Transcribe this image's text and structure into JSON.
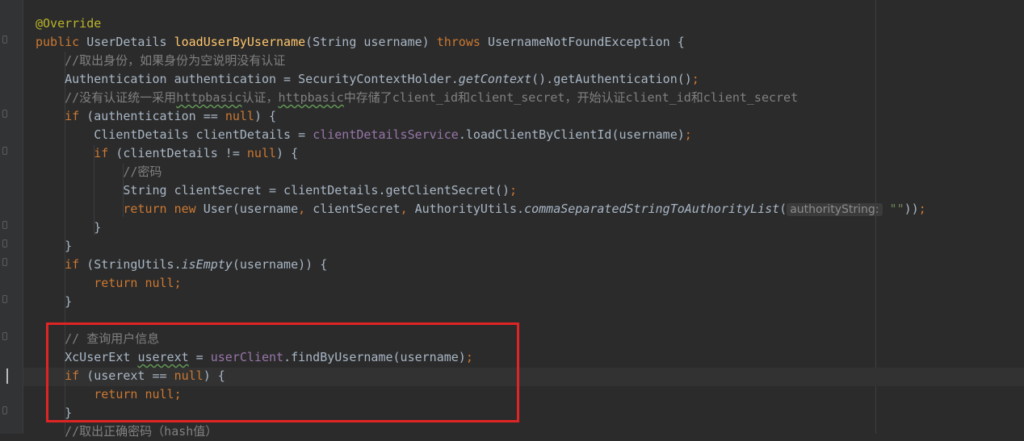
{
  "code_lines": [
    {
      "indent": "",
      "segments": [
        {
          "t": "@Override",
          "c": "ann"
        }
      ]
    },
    {
      "indent": "",
      "segments": [
        {
          "t": "public ",
          "c": "kw"
        },
        {
          "t": "UserDetails "
        },
        {
          "t": "loadUserByUsername",
          "c": "fn"
        },
        {
          "t": "(String username) "
        },
        {
          "t": "throws ",
          "c": "kw"
        },
        {
          "t": "UsernameNotFoundException {"
        }
      ]
    },
    {
      "indent": "    ",
      "segments": [
        {
          "t": "//取出身份，如果身份为空说明没有认证",
          "c": "cmt"
        }
      ]
    },
    {
      "indent": "    ",
      "segments": [
        {
          "t": "Authentication authentication = SecurityContextHolder."
        },
        {
          "t": "getContext",
          "c": "it"
        },
        {
          "t": "().getAuthentication()"
        },
        {
          "t": ";",
          "c": "kw"
        }
      ]
    },
    {
      "indent": "    ",
      "segments": [
        {
          "t": "//没有认证统一采用",
          "c": "cmt"
        },
        {
          "t": "httpbasic",
          "c": "cmt typo"
        },
        {
          "t": "认证，",
          "c": "cmt"
        },
        {
          "t": "httpbasic",
          "c": "cmt typo"
        },
        {
          "t": "中存储了client_id和client_secret，开始认证client_id和client_secret",
          "c": "cmt"
        }
      ]
    },
    {
      "indent": "    ",
      "segments": [
        {
          "t": "if ",
          "c": "kw"
        },
        {
          "t": "(authentication == "
        },
        {
          "t": "null",
          "c": "kw"
        },
        {
          "t": ") {"
        }
      ]
    },
    {
      "indent": "        ",
      "segments": [
        {
          "t": "ClientDetails clientDetails = "
        },
        {
          "t": "clientDetailsService",
          "c": "fld"
        },
        {
          "t": ".loadClientByClientId(username)"
        },
        {
          "t": ";",
          "c": "kw"
        }
      ]
    },
    {
      "indent": "        ",
      "segments": [
        {
          "t": "if ",
          "c": "kw"
        },
        {
          "t": "(clientDetails != "
        },
        {
          "t": "null",
          "c": "kw"
        },
        {
          "t": ") {"
        }
      ]
    },
    {
      "indent": "            ",
      "segments": [
        {
          "t": "//密码",
          "c": "cmt"
        }
      ]
    },
    {
      "indent": "            ",
      "segments": [
        {
          "t": "String clientSecret = clientDetails.getClientSecret()"
        },
        {
          "t": ";",
          "c": "kw"
        }
      ]
    },
    {
      "indent": "            ",
      "segments": [
        {
          "t": "return new ",
          "c": "kw"
        },
        {
          "t": "User(username"
        },
        {
          "t": ", ",
          "c": "kw"
        },
        {
          "t": "clientSecret"
        },
        {
          "t": ", ",
          "c": "kw"
        },
        {
          "t": "AuthorityUtils."
        },
        {
          "t": "commaSeparatedStringToAuthorityList",
          "c": "it"
        },
        {
          "t": "("
        },
        {
          "t": "authorityString:",
          "c": "hint"
        },
        {
          "t": " \"\"",
          "c": "str"
        },
        {
          "t": "))"
        },
        {
          "t": ";",
          "c": "kw"
        }
      ]
    },
    {
      "indent": "        ",
      "segments": [
        {
          "t": "}"
        }
      ]
    },
    {
      "indent": "    ",
      "segments": [
        {
          "t": "}"
        }
      ]
    },
    {
      "indent": "    ",
      "segments": [
        {
          "t": "if ",
          "c": "kw"
        },
        {
          "t": "(StringUtils."
        },
        {
          "t": "isEmpty",
          "c": "it"
        },
        {
          "t": "(username)) {"
        }
      ]
    },
    {
      "indent": "        ",
      "segments": [
        {
          "t": "return null;",
          "c": "kw"
        }
      ]
    },
    {
      "indent": "    ",
      "segments": [
        {
          "t": "}"
        }
      ]
    },
    {
      "indent": "",
      "segments": [
        {
          "t": ""
        }
      ]
    },
    {
      "indent": "    ",
      "segments": [
        {
          "t": "// 查询用户信息",
          "c": "cmt"
        }
      ]
    },
    {
      "indent": "    ",
      "segments": [
        {
          "t": "XcUserExt "
        },
        {
          "t": "userext",
          "c": "typo"
        },
        {
          "t": " = "
        },
        {
          "t": "userClient",
          "c": "fld"
        },
        {
          "t": ".findByUsername(username)"
        },
        {
          "t": ";",
          "c": "kw"
        }
      ]
    },
    {
      "indent": "    ",
      "segments": [
        {
          "t": "if ",
          "c": "kw"
        },
        {
          "t": "(userext == "
        },
        {
          "t": "null",
          "c": "kw"
        },
        {
          "t": ") {"
        }
      ]
    },
    {
      "indent": "        ",
      "segments": [
        {
          "t": "return null;",
          "c": "kw"
        }
      ]
    },
    {
      "indent": "    ",
      "segments": [
        {
          "t": "}"
        }
      ]
    },
    {
      "indent": "    ",
      "segments": [
        {
          "t": "//取出正确密码（hash值）",
          "c": "cmt"
        }
      ]
    }
  ]
}
